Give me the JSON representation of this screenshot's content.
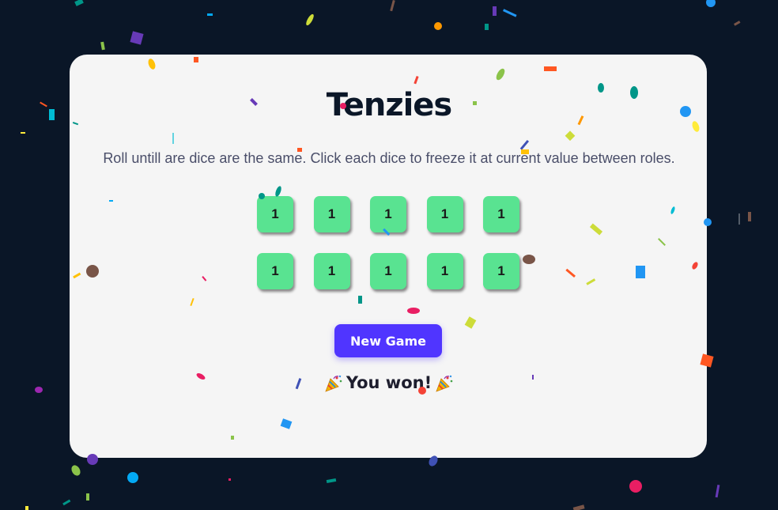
{
  "game": {
    "title": "Tenzies",
    "instructions": "Roll untill are dice are the same. Click each dice to freeze it at current value between roles.",
    "dice": [
      {
        "value": "1",
        "held": true
      },
      {
        "value": "1",
        "held": true
      },
      {
        "value": "1",
        "held": true
      },
      {
        "value": "1",
        "held": true
      },
      {
        "value": "1",
        "held": true
      },
      {
        "value": "1",
        "held": true
      },
      {
        "value": "1",
        "held": true
      },
      {
        "value": "1",
        "held": true
      },
      {
        "value": "1",
        "held": true
      },
      {
        "value": "1",
        "held": true
      }
    ],
    "new_game_label": "New Game",
    "status_text": "You won!",
    "status_icons": [
      "party-popper-icon",
      "party-popper-icon"
    ]
  },
  "colors": {
    "background": "#0a1627",
    "card": "#f5f5f5",
    "die_held": "#59e391",
    "button": "#5035ff",
    "title": "#0b1728"
  }
}
